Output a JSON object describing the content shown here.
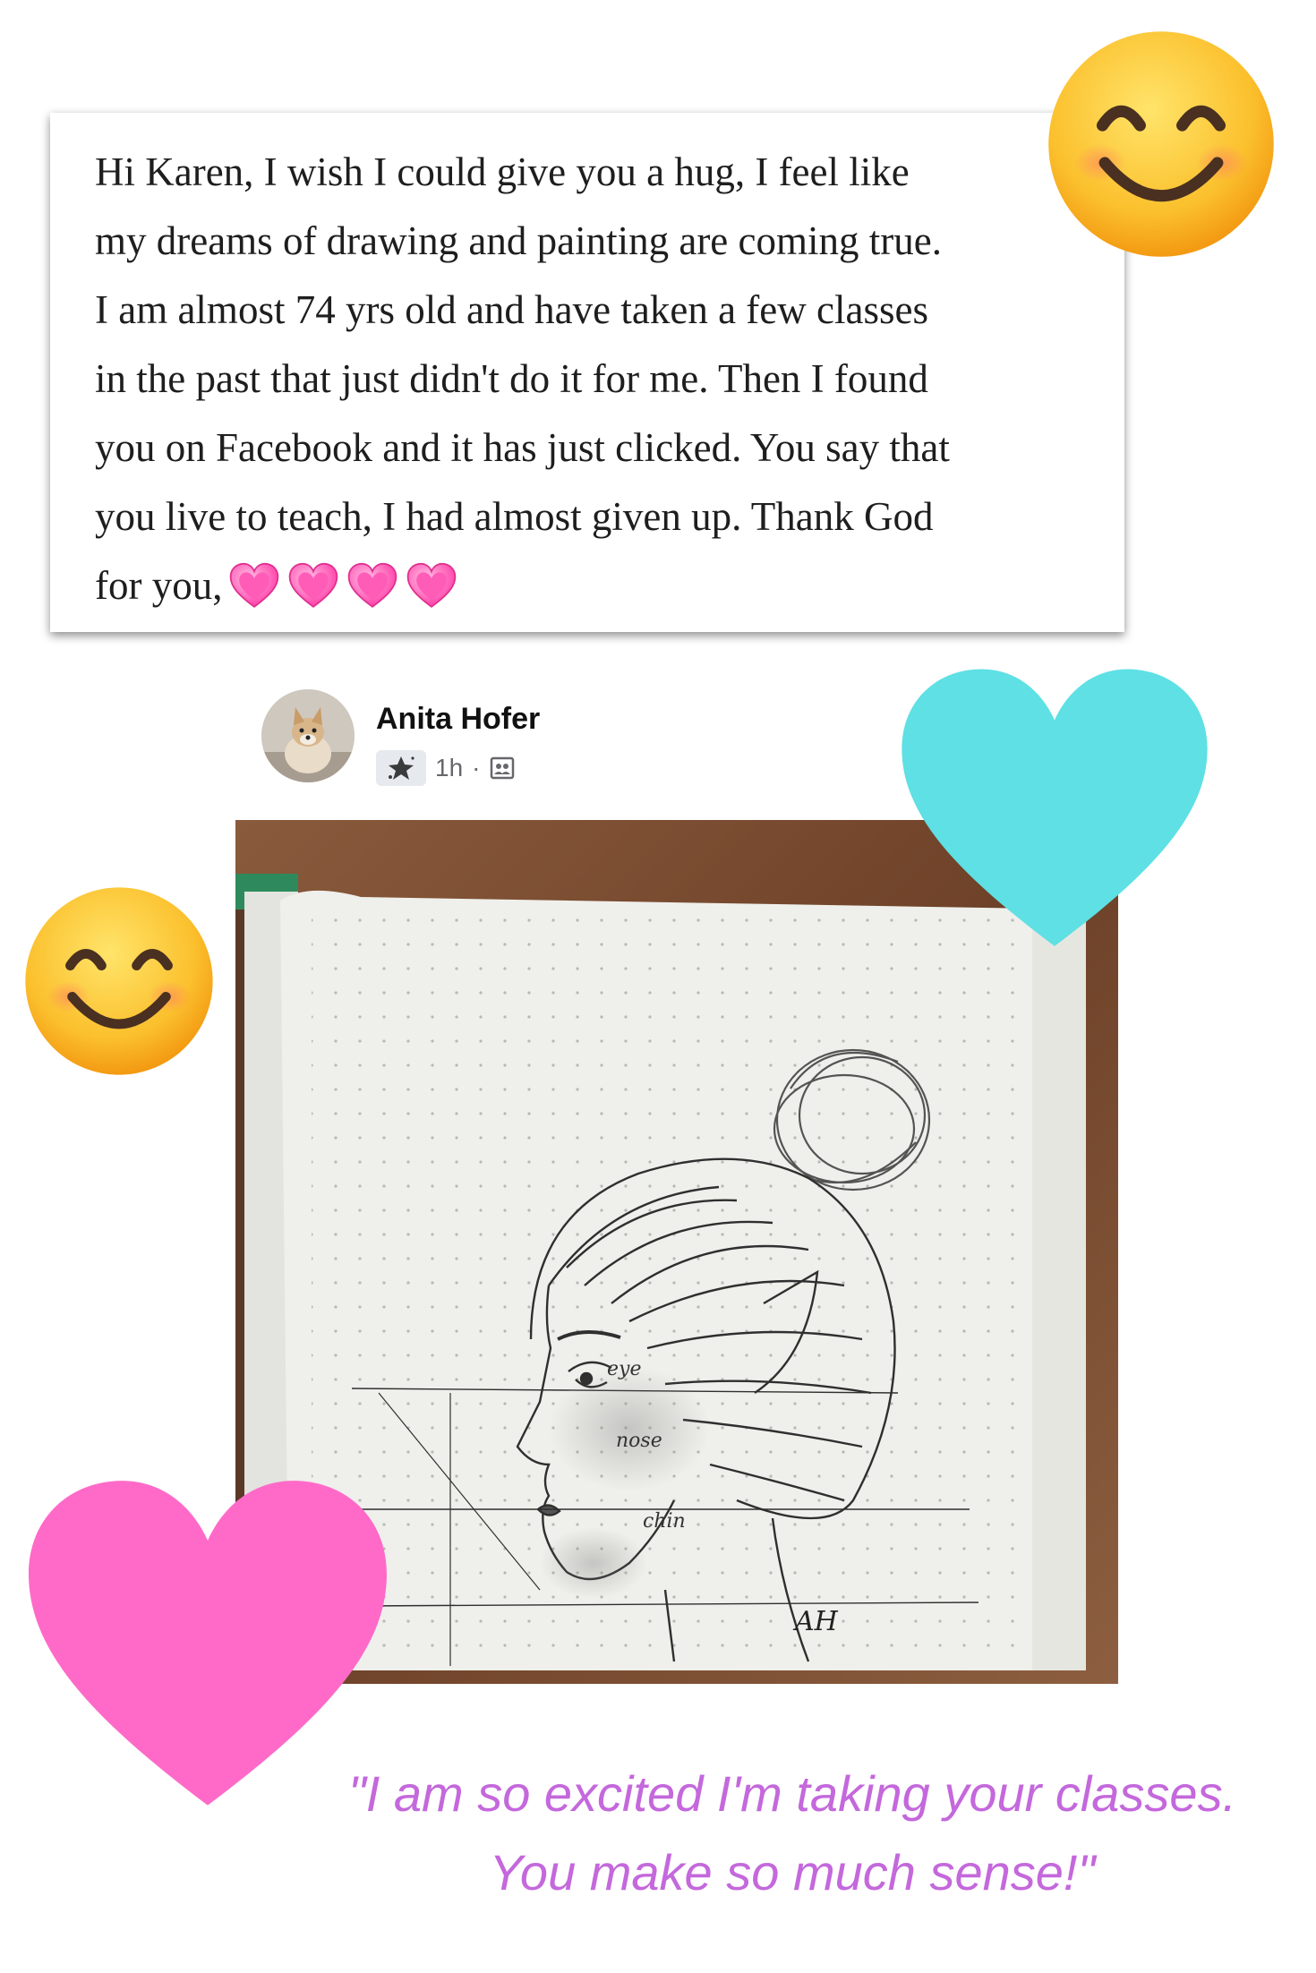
{
  "message": {
    "lines": [
      "Hi Karen, I wish I could give you a hug, I feel like",
      "my dreams of drawing and painting are coming true.",
      "I am almost 74 yrs old and have taken a few classes",
      "in the past that just didn't do it for me. Then I found",
      "you on Facebook and it has just clicked. You say that",
      "you live to teach,  I had almost given up. Thank God",
      "for you,"
    ],
    "heart_count": 4
  },
  "post": {
    "author": "Anita Hofer",
    "time": "1h",
    "separator": "·"
  },
  "sketch": {
    "labels": [
      "eye",
      "nose",
      "chin"
    ],
    "signature": "AH"
  },
  "quote": {
    "line1": "\"I am so excited I'm taking your classes.",
    "line2": "You make so much sense!\""
  },
  "colors": {
    "quote": "#c468dc",
    "teal_heart": "#5ee0e4",
    "pink_heart": "#ff6ac8",
    "emoji_face": "#f9c22e"
  }
}
